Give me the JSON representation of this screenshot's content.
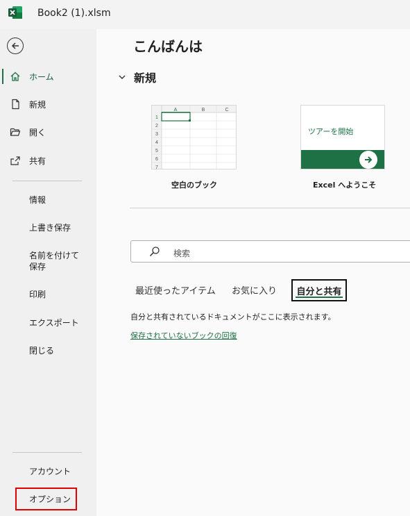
{
  "window": {
    "title": "Book2 (1).xlsm",
    "app_icon": "excel-icon",
    "accent_color": "#1e7145"
  },
  "sidebar": {
    "back_icon": "back-arrow-icon",
    "primary": [
      {
        "label": "ホーム",
        "icon": "home-icon",
        "active": true
      },
      {
        "label": "新規",
        "icon": "new-document-icon"
      },
      {
        "label": "開く",
        "icon": "open-folder-icon"
      },
      {
        "label": "共有",
        "icon": "share-icon"
      }
    ],
    "secondary": [
      {
        "label": "情報"
      },
      {
        "label": "上書き保存"
      },
      {
        "label": "名前を付けて\n保存"
      },
      {
        "label": "印刷"
      },
      {
        "label": "エクスポート"
      },
      {
        "label": "閉じる"
      }
    ],
    "footer": [
      {
        "label": "アカウント"
      },
      {
        "label": "オプション",
        "highlighted": true
      }
    ]
  },
  "main": {
    "greeting": "こんばんは",
    "new_section": {
      "title": "新規",
      "templates": [
        {
          "label": "空白のブック",
          "columns": [
            "A",
            "B",
            "C"
          ],
          "rows": [
            "1",
            "2",
            "3",
            "4",
            "5",
            "6",
            "7"
          ]
        },
        {
          "label": "Excel へようこそ",
          "thumbnail_text": "ツアーを開始"
        }
      ]
    },
    "search": {
      "placeholder": "検索",
      "icon": "search-icon"
    },
    "tabs": [
      {
        "label": "最近使ったアイテム"
      },
      {
        "label": "お気に入り"
      },
      {
        "label": "自分と共有",
        "active": true
      }
    ],
    "shared_message": "自分と共有されているドキュメントがここに表示されます。",
    "unsaved_link": "保存されていないブックの回復"
  }
}
